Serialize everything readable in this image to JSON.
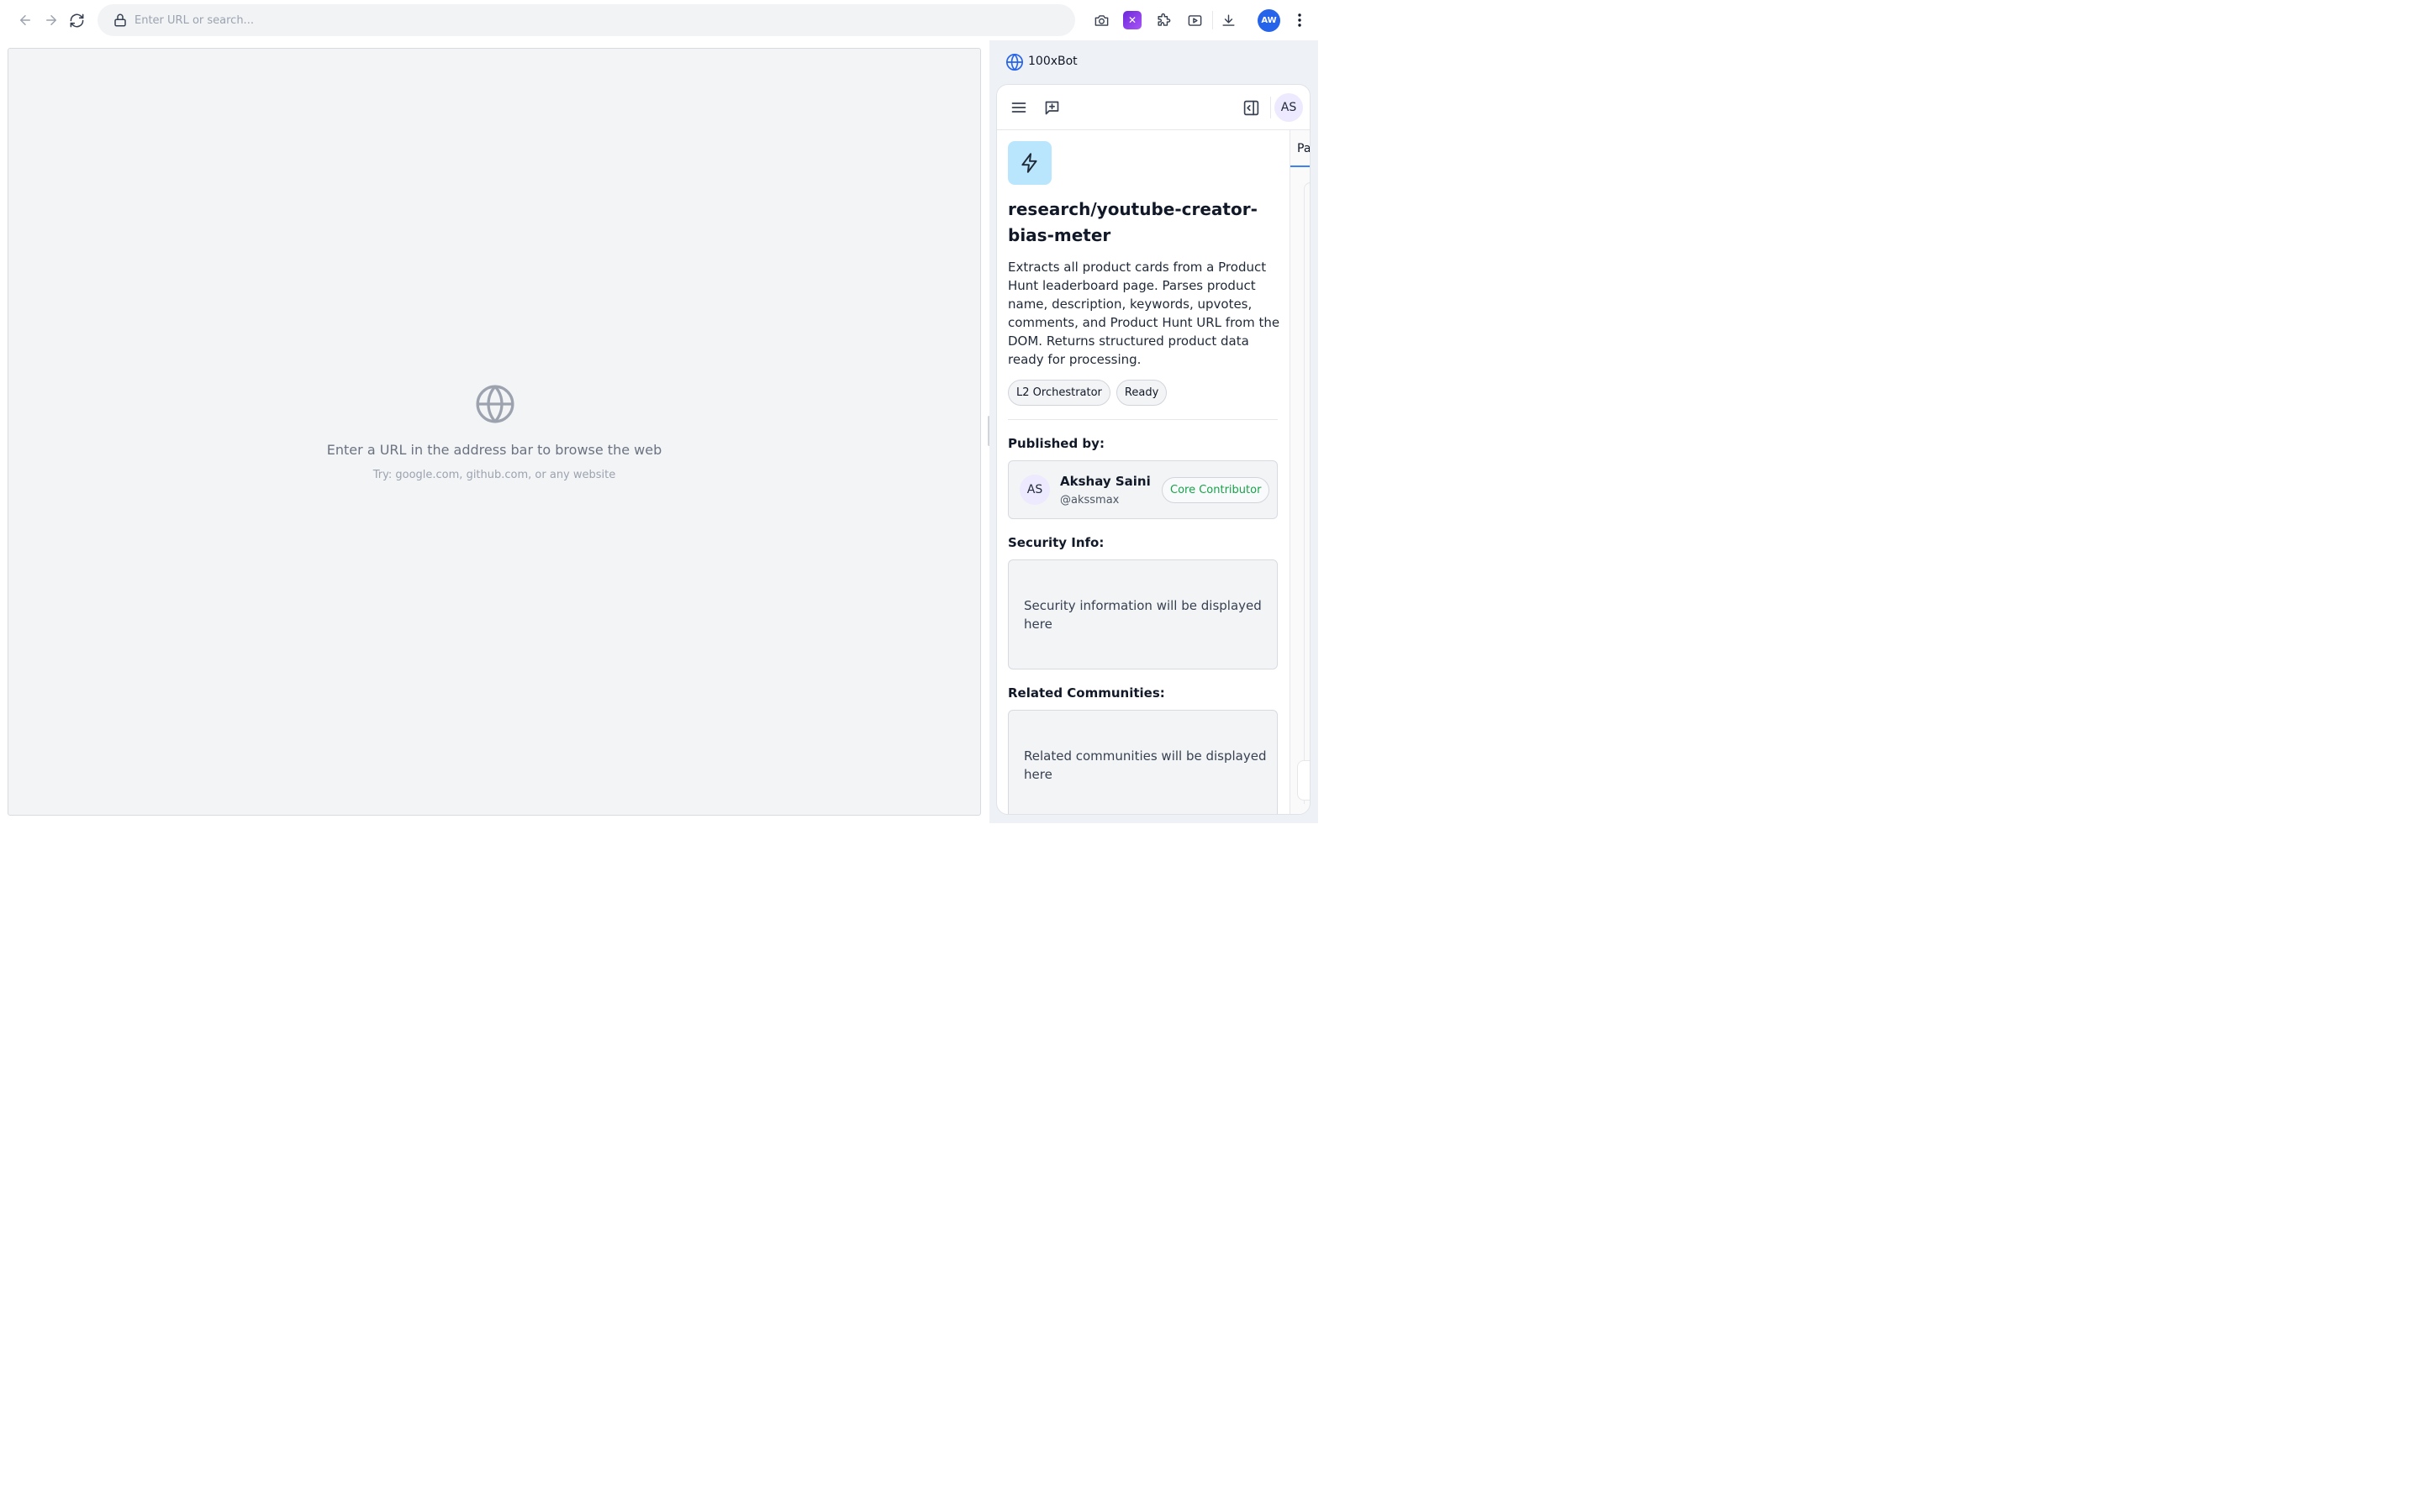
{
  "browser": {
    "url_placeholder": "Enter URL or search...",
    "user_initials": "AW"
  },
  "viewport": {
    "empty_title": "Enter a URL in the address bar to browse the web",
    "empty_hint": "Try: google.com, github.com, or any website"
  },
  "sidebar": {
    "app_name": "100xBot",
    "user_initials": "AS",
    "tool": {
      "title": "research/youtube-creator-bias-meter",
      "description": "Extracts all product cards from a Product Hunt leaderboard page. Parses product name, description, keywords, upvotes, comments, and Product Hunt URL from the DOM. Returns structured product data ready for processing.",
      "chips": [
        "L2 Orchestrator",
        "Ready"
      ]
    },
    "published_label": "Published by:",
    "publisher": {
      "initials": "AS",
      "name": "Akshay Saini",
      "handle": "@akssmax",
      "badge": "Core Contributor"
    },
    "security_label": "Security Info:",
    "security_text": "Security information will be displayed here",
    "communities_label": "Related Communities:",
    "communities_text": "Related communities will be displayed here",
    "peek_tab": "Pa"
  },
  "colors": {
    "accent": "#2563eb",
    "bolt_bg": "#bae6fd",
    "badge_green": "#16a34a"
  }
}
